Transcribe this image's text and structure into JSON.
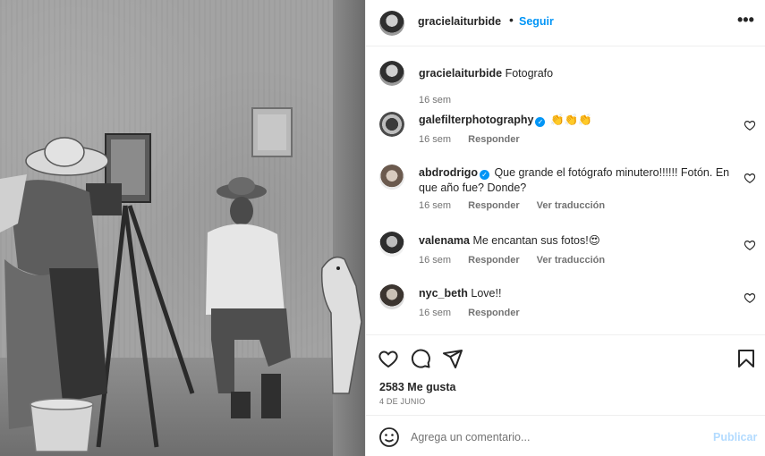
{
  "post": {
    "username": "gracielaiturbide",
    "follow_label": "Seguir",
    "more_label": "•••",
    "caption": {
      "username": "gracielaiturbide",
      "text": "Fotografo",
      "time": "16 sem"
    },
    "comments": [
      {
        "username": "galefilterphotography",
        "verified": true,
        "text": "👏👏👏",
        "time": "16 sem",
        "reply": "Responder",
        "translate": ""
      },
      {
        "username": "abdrodrigo",
        "verified": true,
        "text": "Que grande el fotógrafo minutero!!!!!! Fotón. En que año fue? Donde?",
        "time": "16 sem",
        "reply": "Responder",
        "translate": "Ver traducción"
      },
      {
        "username": "valenama",
        "verified": false,
        "text": "Me encantan sus fotos!😍",
        "time": "16 sem",
        "reply": "Responder",
        "translate": "Ver traducción"
      },
      {
        "username": "nyc_beth",
        "verified": false,
        "text": "Love!!",
        "time": "16 sem",
        "reply": "Responder",
        "translate": ""
      }
    ],
    "likes": "2583 Me gusta",
    "date": "4 DE JUNIO",
    "comment_placeholder": "Agrega un comentario...",
    "publish_label": "Publicar"
  },
  "colors": {
    "accent": "#0095f6",
    "publish_disabled": "#b3dbff",
    "text": "#262626",
    "secondary": "#737373",
    "border": "#efefef"
  },
  "icons": [
    "heart-icon",
    "comment-icon",
    "share-icon",
    "bookmark-icon",
    "emoji-icon",
    "verified-badge-icon",
    "more-options-icon"
  ]
}
